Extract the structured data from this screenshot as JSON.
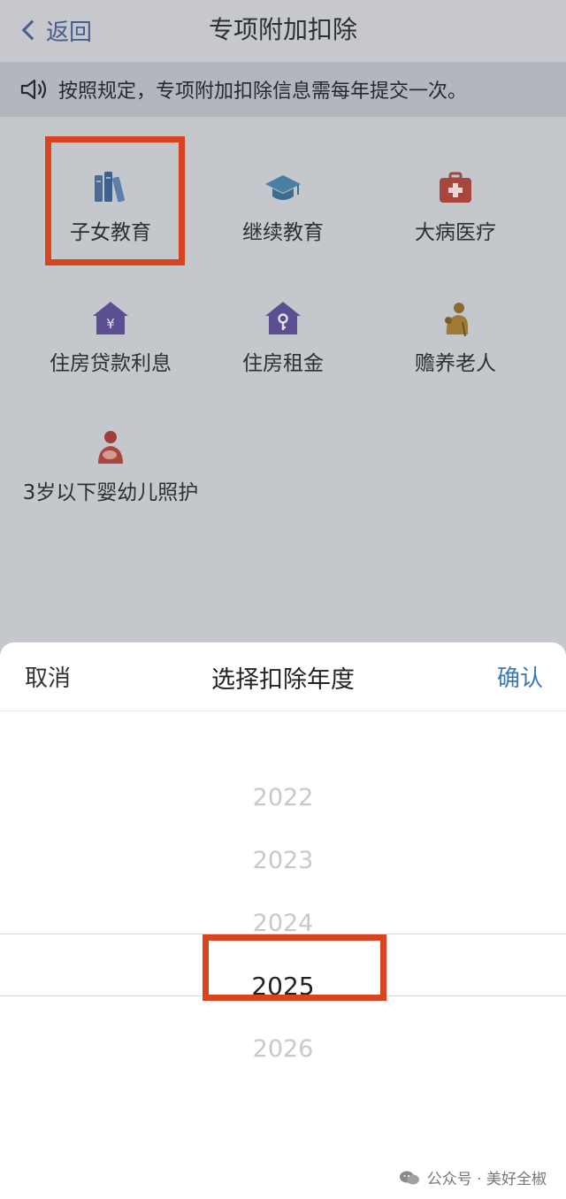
{
  "header": {
    "back_label": "返回",
    "title": "专项附加扣除"
  },
  "notice": {
    "text": "按照规定，专项附加扣除信息需每年提交一次。"
  },
  "categories": [
    {
      "label": "子女教育"
    },
    {
      "label": "继续教育"
    },
    {
      "label": "大病医疗"
    },
    {
      "label": "住房贷款利息"
    },
    {
      "label": "住房租金"
    },
    {
      "label": "赡养老人"
    },
    {
      "label": "3岁以下婴幼儿照护"
    }
  ],
  "sheet": {
    "cancel": "取消",
    "title": "选择扣除年度",
    "confirm": "确认",
    "years": [
      "2022",
      "2023",
      "2024",
      "2025",
      "2026"
    ],
    "selected_year": "2025"
  },
  "watermark": {
    "text": "公众号 · 美好全椒"
  },
  "colors": {
    "accent": "#3a78b5",
    "highlight": "#d9441f",
    "back": "#475d8c"
  }
}
